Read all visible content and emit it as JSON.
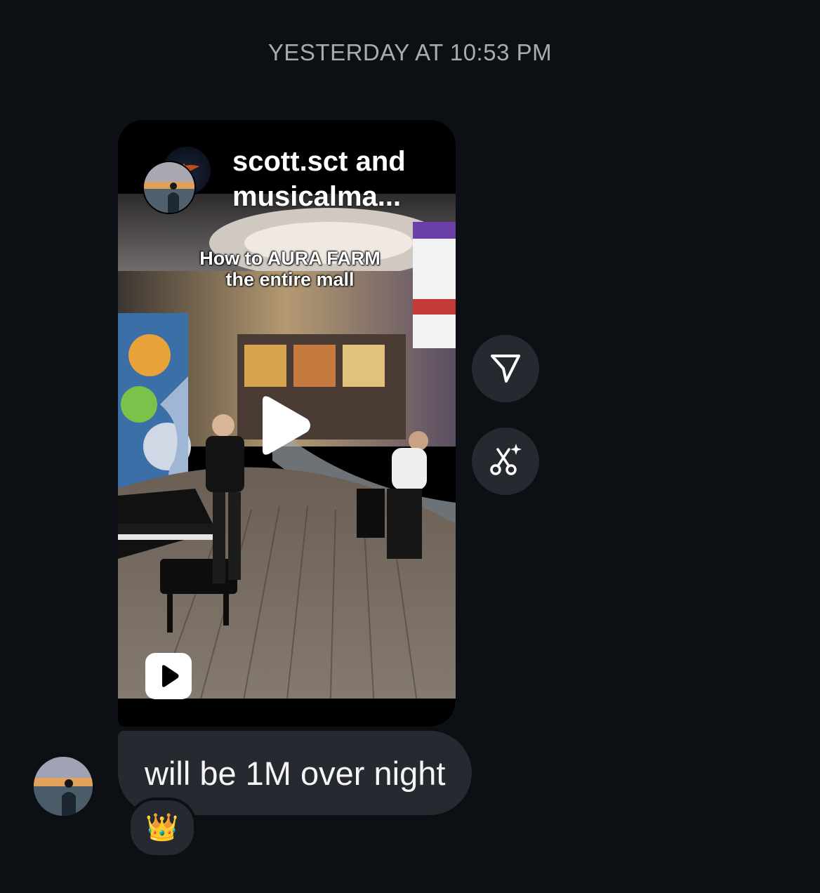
{
  "timestamp": "YESTERDAY AT 10:53 PM",
  "reel": {
    "title": "scott.sct and musicalma...",
    "caption": "How to AURA FARM the entire mall",
    "play_icon": "play-icon",
    "badge_icon": "reels-icon"
  },
  "actions": {
    "share_icon": "paper-plane-icon",
    "remix_icon": "scissors-sparkle-icon"
  },
  "message": {
    "text": "will be 1M over night",
    "reaction": "👑"
  },
  "colors": {
    "background": "#0c1014",
    "bubble": "#262a30",
    "timestamp": "#a8acb2"
  }
}
